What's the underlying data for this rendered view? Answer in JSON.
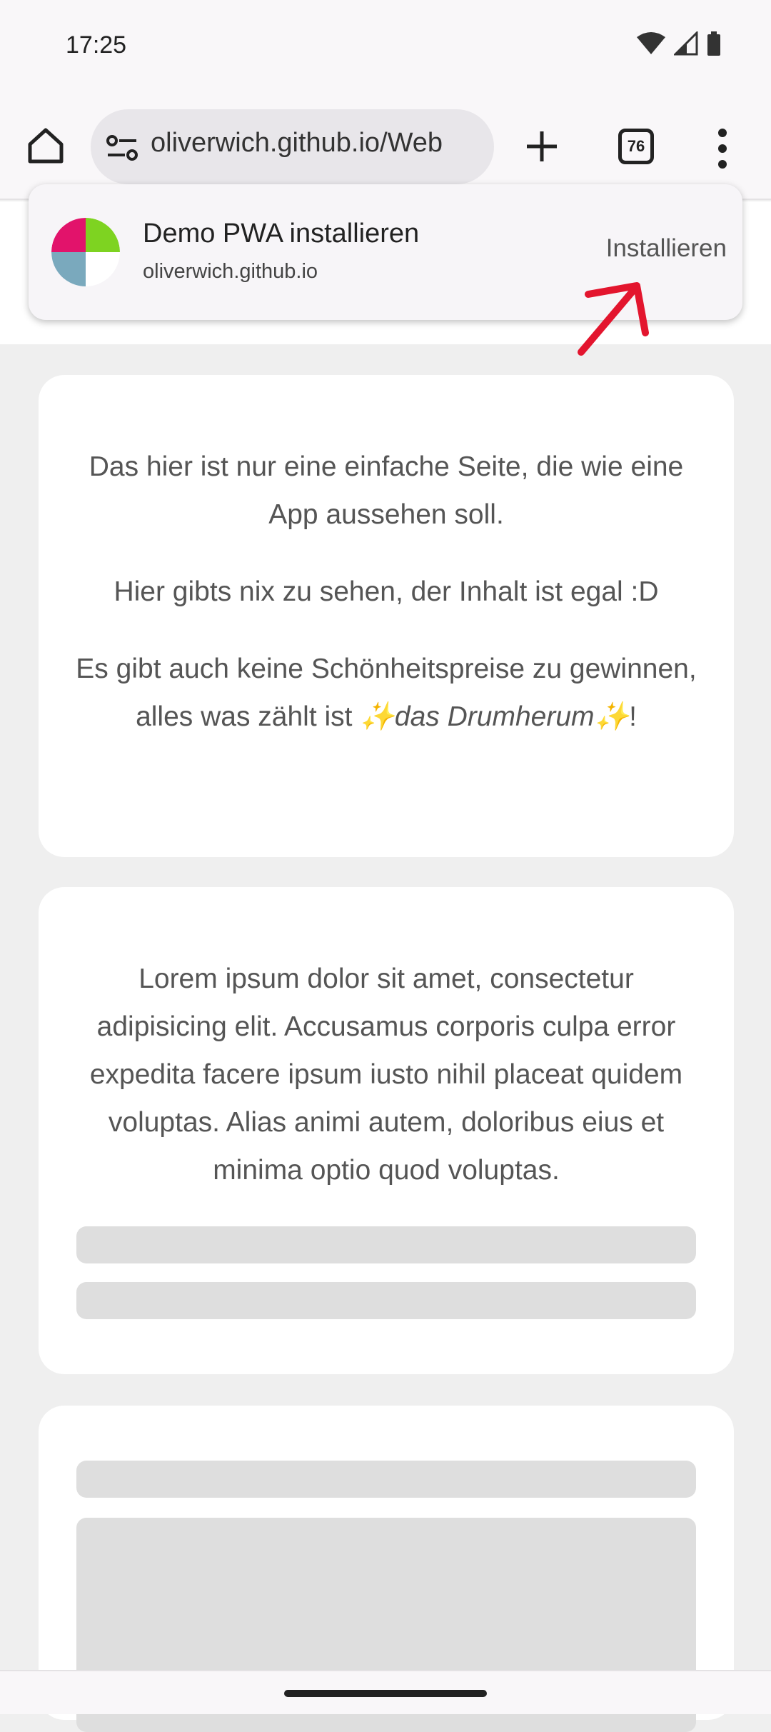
{
  "status": {
    "time": "17:25",
    "icons": [
      "wifi-icon",
      "signal-icon",
      "battery-icon"
    ]
  },
  "toolbar": {
    "url": "oliverwich.github.io/Web",
    "tab_count": "76",
    "icons": [
      "home-icon",
      "site-settings-icon",
      "new-tab-plus-icon",
      "tabs-icon",
      "more-menu-icon"
    ]
  },
  "install_prompt": {
    "title": "Demo PWA installieren",
    "domain": "oliverwich.github.io",
    "button": "Installieren",
    "icon_colors": [
      "#e2136b",
      "#7ed321",
      "#7aa9bd",
      "#ffffff"
    ],
    "annotation_color": "#e3152e"
  },
  "card1": {
    "p1": "Das hier ist nur eine einfache Seite, die wie eine App aussehen soll.",
    "p2": "Hier gibts nix zu sehen, der Inhalt ist egal :D",
    "p3_start": "Es gibt auch keine Schönheitspreise zu gewinnen, alles was zählt ist ",
    "p3_em": "✨das Drumherum✨",
    "p3_end": "!"
  },
  "card2": {
    "text": "Lorem ipsum dolor sit amet, consectetur adipisicing elit. Accusamus corporis culpa error expedita facere ipsum iusto nihil placeat quidem voluptas. Alias animi autem, doloribus eius et minima optio quod voluptas."
  }
}
